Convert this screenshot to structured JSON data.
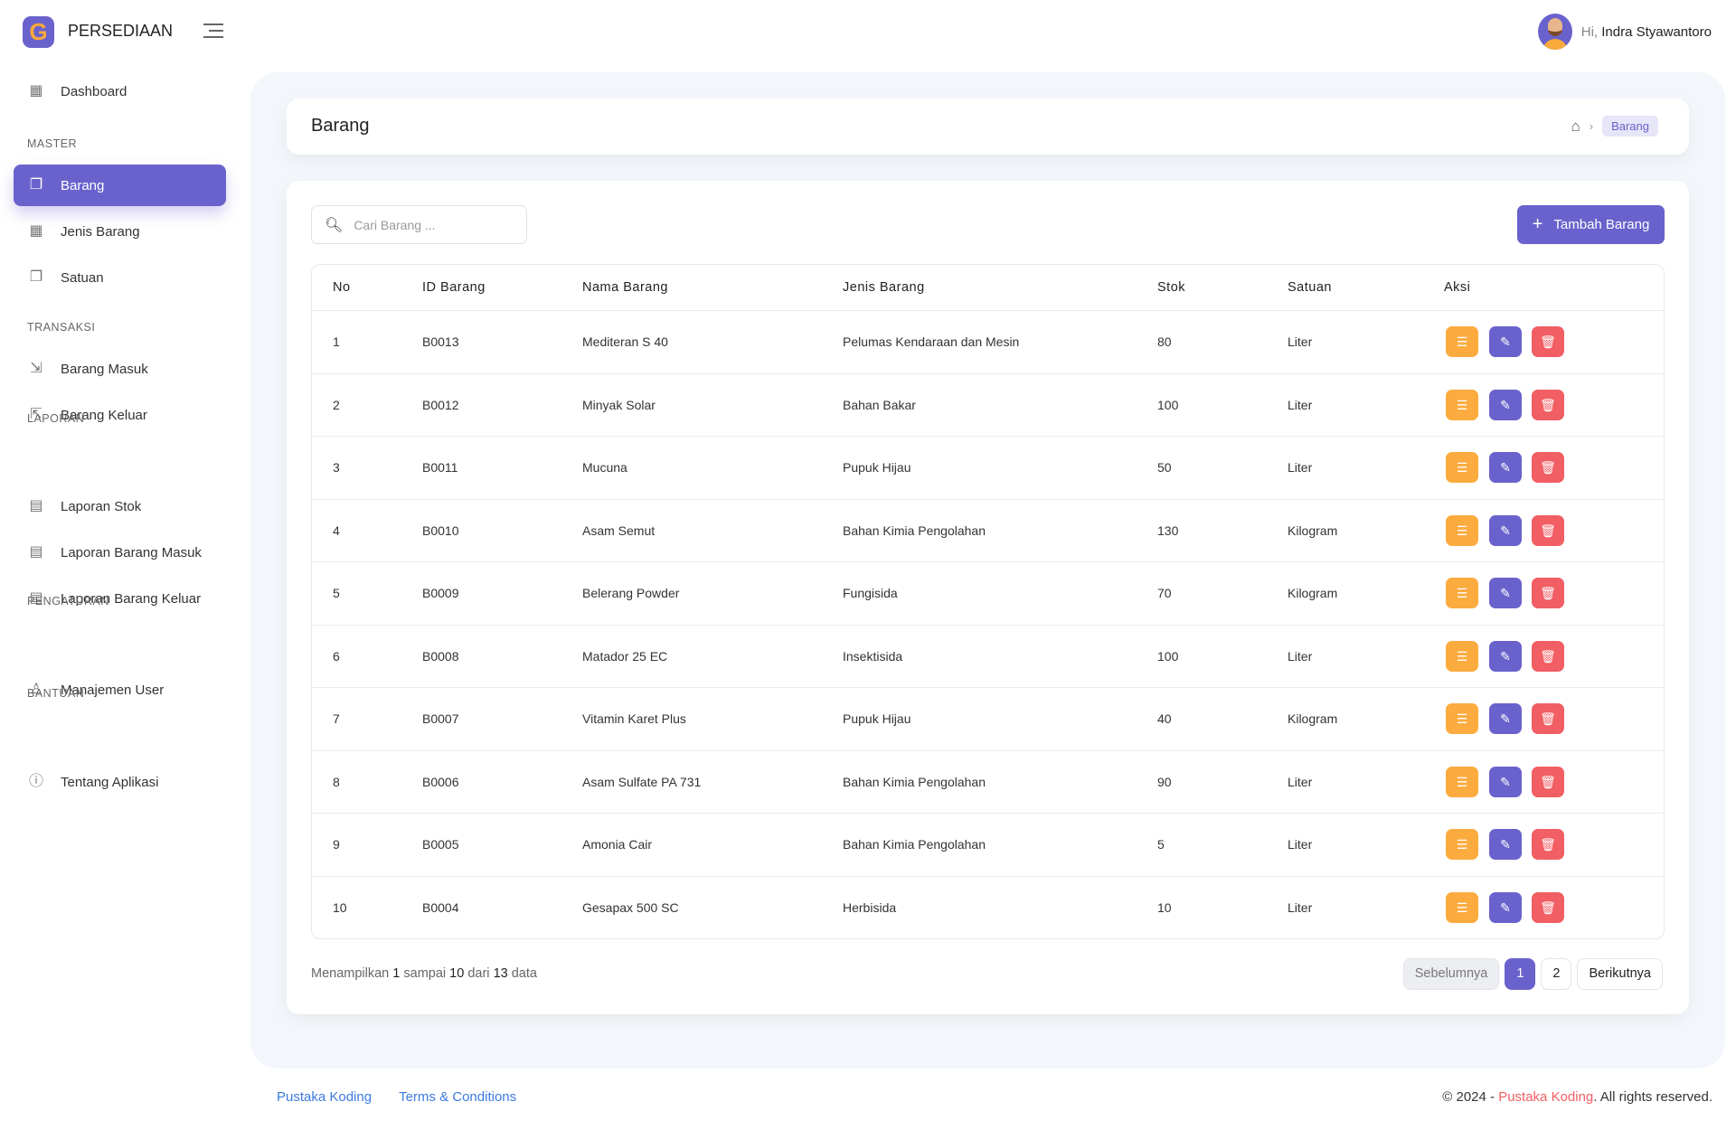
{
  "app": {
    "logo_letter": "G",
    "brand": "PERSEDIAAN",
    "accent": "#6a62cc"
  },
  "user": {
    "greeting": "Hi,",
    "name": "Indra Styawantoro"
  },
  "sidebar": {
    "items": [
      {
        "label": "Dashboard",
        "icon": "grid-icon",
        "section": null
      },
      {
        "label": "Barang",
        "icon": "copy-icon",
        "active": true
      },
      {
        "label": "Jenis Barang",
        "icon": "grid-icon"
      },
      {
        "label": "Satuan",
        "icon": "copy-icon"
      },
      {
        "label": "Barang Masuk",
        "icon": "import-icon"
      },
      {
        "label": "Barang Keluar",
        "icon": "export-icon"
      },
      {
        "label": "Laporan Stok",
        "icon": "report-icon"
      },
      {
        "label": "Laporan Barang Masuk",
        "icon": "report-icon"
      },
      {
        "label": "Laporan Barang Keluar",
        "icon": "report-icon"
      },
      {
        "label": "Manajemen User",
        "icon": "user-icon"
      },
      {
        "label": "Tentang Aplikasi",
        "icon": "info-icon"
      }
    ],
    "sections": [
      "MASTER",
      "TRANSAKSI",
      "LAPORAN",
      "PENGATURAN",
      "BANTUAN"
    ]
  },
  "page": {
    "title": "Barang",
    "breadcrumb_current": "Barang"
  },
  "search": {
    "placeholder": "Cari Barang ..."
  },
  "add_button": "Tambah Barang",
  "table": {
    "columns": [
      "No",
      "ID Barang",
      "Nama Barang",
      "Jenis Barang",
      "Stok",
      "Satuan",
      "Aksi"
    ],
    "rows": [
      [
        "1",
        "B0013",
        "Mediteran S 40",
        "Pelumas Kendaraan dan Mesin",
        "80",
        "Liter"
      ],
      [
        "2",
        "B0012",
        "Minyak Solar",
        "Bahan Bakar",
        "100",
        "Liter"
      ],
      [
        "3",
        "B0011",
        "Mucuna",
        "Pupuk Hijau",
        "50",
        "Liter"
      ],
      [
        "4",
        "B0010",
        "Asam Semut",
        "Bahan Kimia Pengolahan",
        "130",
        "Kilogram"
      ],
      [
        "5",
        "B0009",
        "Belerang Powder",
        "Fungisida",
        "70",
        "Kilogram"
      ],
      [
        "6",
        "B0008",
        "Matador 25 EC",
        "Insektisida",
        "100",
        "Liter"
      ],
      [
        "7",
        "B0007",
        "Vitamin Karet Plus",
        "Pupuk Hijau",
        "40",
        "Kilogram"
      ],
      [
        "8",
        "B0006",
        "Asam Sulfate PA 731",
        "Bahan Kimia Pengolahan",
        "90",
        "Liter"
      ],
      [
        "9",
        "B0005",
        "Amonia Cair",
        "Bahan Kimia Pengolahan",
        "5",
        "Liter"
      ],
      [
        "10",
        "B0004",
        "Gesapax 500 SC",
        "Herbisida",
        "10",
        "Liter"
      ]
    ],
    "action_colors": {
      "detail": "#fcab3f",
      "edit": "#6a62cc",
      "delete": "#f15e64"
    }
  },
  "info": {
    "prefix": "Menampilkan",
    "from": "1",
    "mid1": "sampai",
    "to": "10",
    "mid2": "dari",
    "total": "13",
    "suffix": "data"
  },
  "pagination": {
    "prev": "Sebelumnya",
    "pages": [
      "1",
      "2"
    ],
    "current": "1",
    "next": "Berikutnya"
  },
  "footer": {
    "link1": "Pustaka Koding",
    "link2": "Terms & Conditions",
    "copy": "© 2024 -",
    "brand": "Pustaka Koding",
    "rights": ". All rights reserved."
  }
}
